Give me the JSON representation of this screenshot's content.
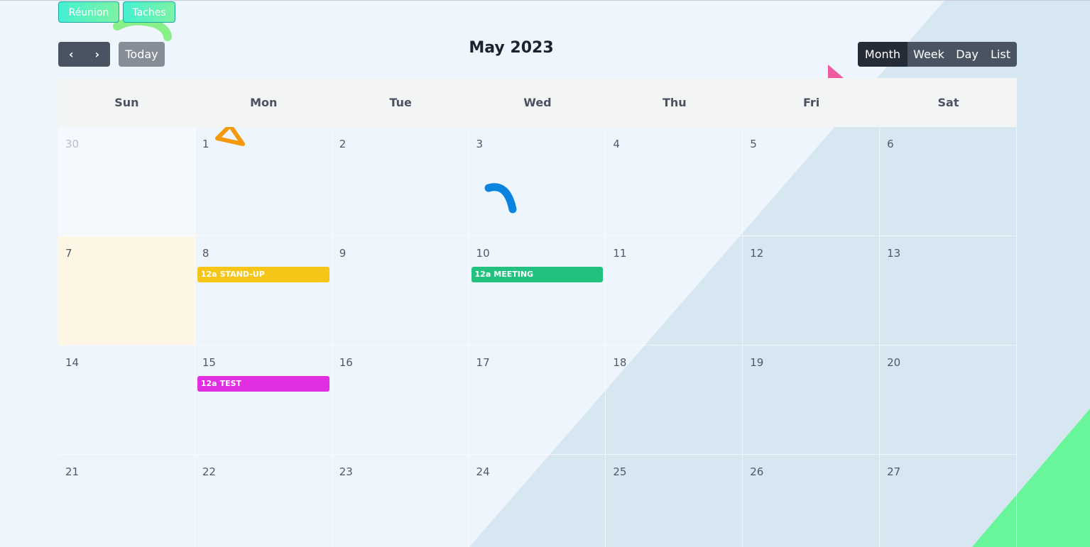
{
  "categories": [
    "Réunion",
    "Taches"
  ],
  "toolbar": {
    "prev_icon": "chevron-left-icon",
    "next_icon": "chevron-right-icon",
    "prev_glyph": "‹",
    "next_glyph": "›",
    "today_label": "Today",
    "title": "May 2023",
    "views": [
      "Month",
      "Week",
      "Day",
      "List"
    ],
    "active_view": "Month"
  },
  "calendar": {
    "weekdays": [
      "Sun",
      "Mon",
      "Tue",
      "Wed",
      "Thu",
      "Fri",
      "Sat"
    ],
    "weeks": [
      [
        {
          "day": "30",
          "other_month": true
        },
        {
          "day": "1"
        },
        {
          "day": "2"
        },
        {
          "day": "3"
        },
        {
          "day": "4"
        },
        {
          "day": "5"
        },
        {
          "day": "6"
        }
      ],
      [
        {
          "day": "7",
          "today": true
        },
        {
          "day": "8",
          "events": [
            {
              "time": "12a",
              "title": "STAND-UP",
              "color": "#f5c518"
            }
          ]
        },
        {
          "day": "9"
        },
        {
          "day": "10",
          "events": [
            {
              "time": "12a",
              "title": "MEETING",
              "color": "#22c17f"
            }
          ]
        },
        {
          "day": "11"
        },
        {
          "day": "12"
        },
        {
          "day": "13"
        }
      ],
      [
        {
          "day": "14"
        },
        {
          "day": "15",
          "events": [
            {
              "time": "12a",
              "title": "TEST",
              "color": "#e02ee0"
            }
          ]
        },
        {
          "day": "16"
        },
        {
          "day": "17"
        },
        {
          "day": "18"
        },
        {
          "day": "19"
        },
        {
          "day": "20"
        }
      ],
      [
        {
          "day": "21"
        },
        {
          "day": "22"
        },
        {
          "day": "23"
        },
        {
          "day": "24"
        },
        {
          "day": "25"
        },
        {
          "day": "26"
        },
        {
          "day": "27"
        }
      ]
    ]
  },
  "colors": {
    "background": "#eef5fc",
    "diagonal_band": "#d7e7f1",
    "corner_accent": "#69f59a",
    "loading_spinner": "#0a84e0"
  },
  "icons": [
    "loading-spinner-icon",
    "triangle-deco-icon"
  ]
}
